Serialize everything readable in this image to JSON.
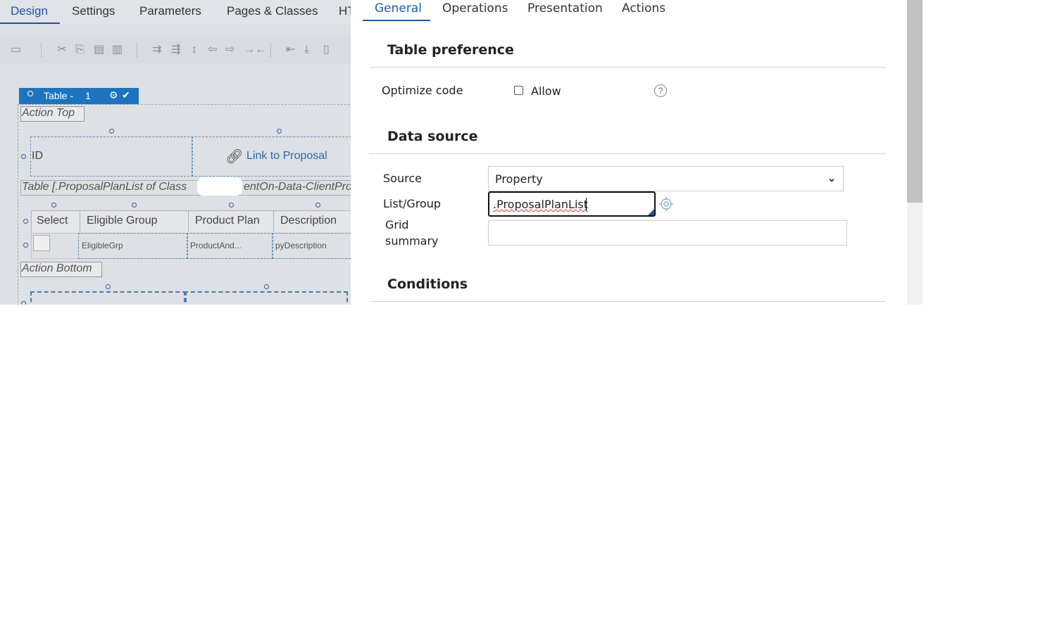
{
  "designer": {
    "tabs": [
      "Design",
      "Settings",
      "Parameters",
      "Pages & Classes",
      "HT"
    ],
    "table_tag": {
      "label": "Table -",
      "number": "1"
    },
    "action_top": "Action Top",
    "action_bottom": "Action Bottom",
    "id_label": "ID",
    "link_label": "Link to Proposal",
    "table_source_text": "Table [.ProposalPlanList of Class",
    "table_source_text_right": "entOn-Data-ClientPro",
    "columns": [
      "Select",
      "Eligible Group",
      "Product Plan",
      "Description"
    ],
    "row_cells": [
      "EligibleGrp",
      "ProductAnd...",
      "pyDescription"
    ]
  },
  "panel": {
    "tabs": [
      "General",
      "Operations",
      "Presentation",
      "Actions"
    ],
    "table_preference": {
      "title": "Table preference",
      "optimize_label": "Optimize code",
      "allow_label": "Allow",
      "help_glyph": "?"
    },
    "data_source": {
      "title": "Data source",
      "source_label": "Source",
      "source_value": "Property",
      "list_group_label": "List/Group",
      "list_group_value": ".ProposalPlanList",
      "grid_summary_label_1": "Grid",
      "grid_summary_label_2": "summary",
      "grid_summary_value": ""
    },
    "conditions": {
      "title": "Conditions"
    }
  },
  "colors": {
    "accent": "#1f5aa8",
    "tag_blue": "#1e73be"
  }
}
